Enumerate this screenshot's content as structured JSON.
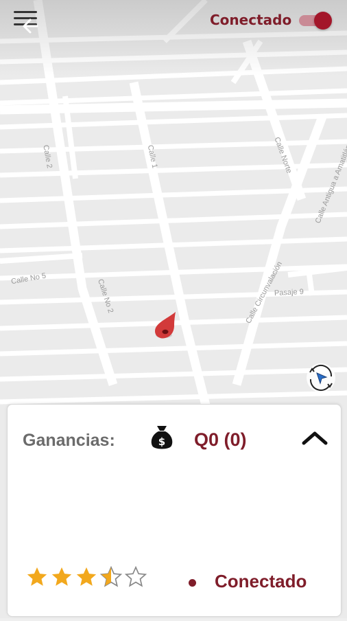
{
  "header": {
    "menu_icon": "hamburger-menu-icon",
    "back_icon": "back-arrow-icon",
    "status_label": "Conectado",
    "online_toggle_on": true
  },
  "map": {
    "street_labels": {
      "calle_5": "Calle No 5",
      "calle_2": "Calle No 2",
      "calle_1": "Calle 1",
      "pasaje_9": "Pasaje 9",
      "calle_circunvalacion": "Calle Circunvalación",
      "calle_antigua": "Calle Antigua a Amatitlán",
      "calle_left": "Calle 2",
      "calle_norte": "Calle Norte"
    },
    "location_pin_icon": "location-pin-icon",
    "recenter_icon": "recenter-location-icon"
  },
  "panel": {
    "earnings_label": "Ganancias:",
    "money_bag_icon": "money-bag-icon",
    "earnings_value": "Q0 (0)",
    "collapse_icon": "chevron-up-icon",
    "rating": 3.5,
    "rating_max": 5,
    "status_label": "Conectado"
  },
  "colors": {
    "brand": "#7f1d2a",
    "pin": "#d23a3a",
    "star": "#f2a81d"
  }
}
